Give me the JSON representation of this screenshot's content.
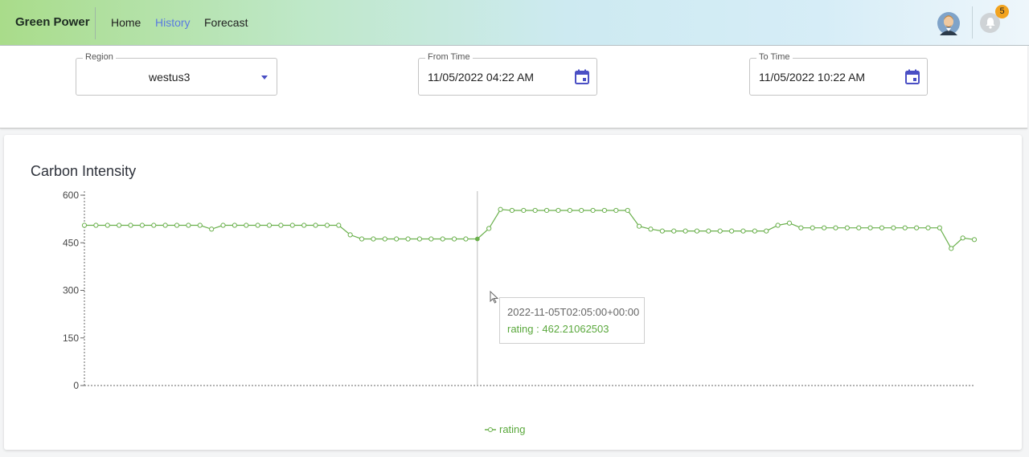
{
  "app": {
    "brand": "Green Power"
  },
  "nav": [
    {
      "label": "Home",
      "active": false
    },
    {
      "label": "History",
      "active": true
    },
    {
      "label": "Forecast",
      "active": false
    }
  ],
  "header_icons": {
    "avatar": "user-avatar",
    "notifications_count": "5",
    "notifications_icon": "bell-icon"
  },
  "filters": {
    "region_label": "Region",
    "region_value": "westus3",
    "from_label": "From Time",
    "from_value": "11/05/2022 04:22 AM",
    "to_label": "To Time",
    "to_value": "11/05/2022 10:22 AM"
  },
  "chart_title": "Carbon Intensity",
  "tooltip": {
    "time": "2022-11-05T02:05:00+00:00",
    "rating": "rating : 462.21062503"
  },
  "chart_data": {
    "type": "line",
    "title": "Carbon Intensity",
    "ylim": [
      0,
      600
    ],
    "yticks": [
      "0",
      "150",
      "300",
      "450",
      "600"
    ],
    "series": [
      {
        "name": "rating",
        "color": "#6ab04c",
        "values": [
          505,
          505,
          505,
          505,
          505,
          505,
          505,
          505,
          505,
          505,
          505,
          493,
          505,
          505,
          505,
          505,
          505,
          505,
          505,
          505,
          505,
          505,
          505,
          475,
          462,
          462,
          462,
          462,
          462,
          462,
          462,
          462,
          462,
          462,
          462,
          495,
          555,
          552,
          552,
          552,
          552,
          552,
          552,
          552,
          552,
          552,
          552,
          552,
          502,
          493,
          487,
          487,
          487,
          487,
          487,
          487,
          487,
          487,
          487,
          487,
          505,
          512,
          497,
          497,
          497,
          497,
          497,
          497,
          497,
          497,
          497,
          497,
          497,
          497,
          497,
          432,
          465,
          460
        ]
      }
    ],
    "highlight_index": 34,
    "legend": "bottom-center",
    "legend_label": "rating"
  }
}
